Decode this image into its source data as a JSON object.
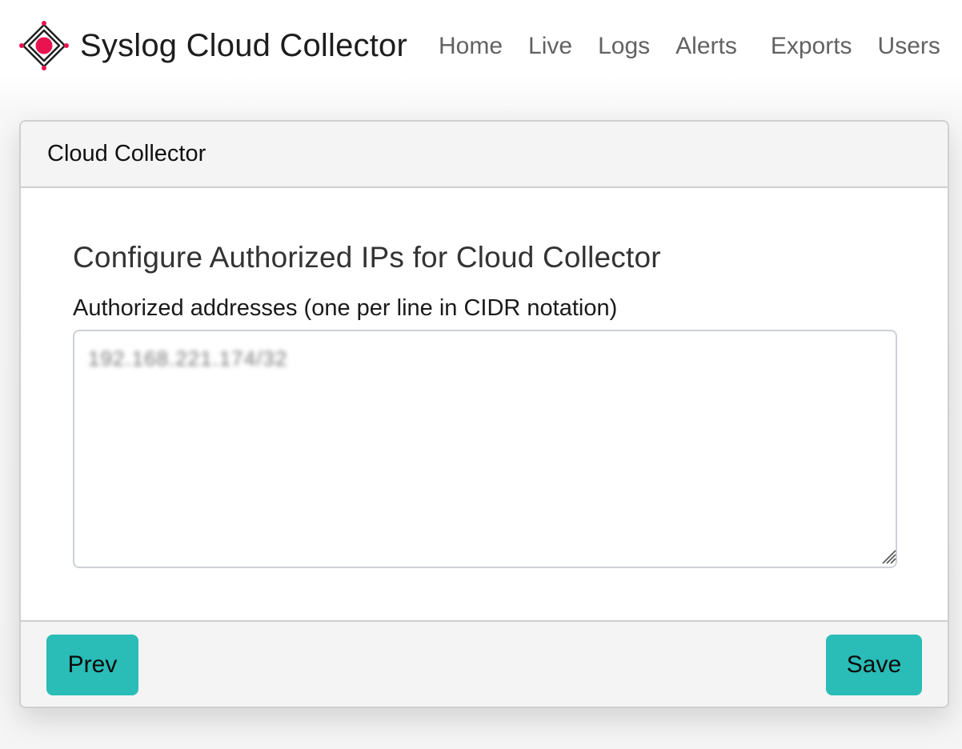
{
  "app": {
    "brand_name": "Syslog Cloud Collector",
    "brand_icon": "syslog-logo-icon",
    "accent_color": "#e8134f"
  },
  "nav": {
    "items": [
      {
        "label": "Home"
      },
      {
        "label": "Live"
      },
      {
        "label": "Logs"
      },
      {
        "label": "Alerts"
      },
      {
        "label": "Exports"
      },
      {
        "label": "Users"
      }
    ]
  },
  "card": {
    "title": "Cloud Collector",
    "section_title": "Configure Authorized IPs for Cloud Collector",
    "field_label": "Authorized addresses (one per line in CIDR notation)",
    "field_value": "192.168.221.174/32",
    "buttons": {
      "prev_label": "Prev",
      "save_label": "Save",
      "color": "#2abcb6"
    }
  }
}
